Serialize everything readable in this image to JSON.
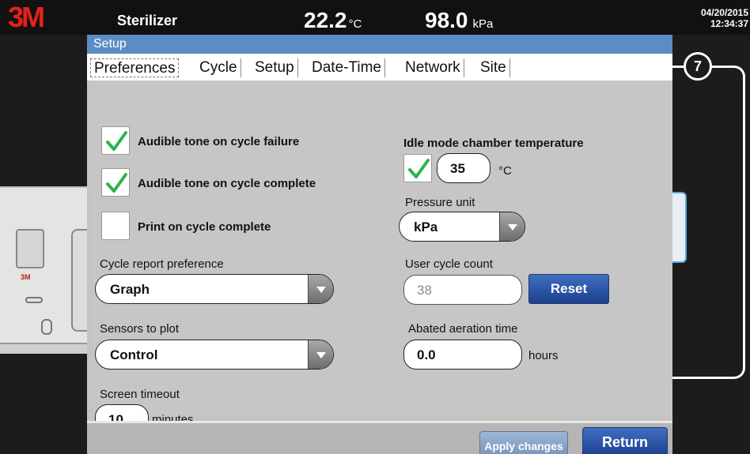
{
  "header": {
    "logo": "3M",
    "app_name": "Sterilizer",
    "temperature": "22.2",
    "temperature_unit": "°C",
    "pressure": "98.0",
    "pressure_unit": "kPa",
    "date": "04/20/2015",
    "time": "12:34:37"
  },
  "callout": {
    "number": "7"
  },
  "background": {
    "machine_logo": "3M"
  },
  "dialog": {
    "title": "Setup",
    "tabs": [
      {
        "label": "Preferences",
        "active": true
      },
      {
        "label": "Cycle",
        "active": false
      },
      {
        "label": "Setup",
        "active": false
      },
      {
        "label": "Date-Time",
        "active": false
      },
      {
        "label": "Network",
        "active": false
      },
      {
        "label": "Site",
        "active": false
      }
    ],
    "left": {
      "audible_failure": {
        "label": "Audible tone on cycle failure",
        "checked": true
      },
      "audible_complete": {
        "label": "Audible tone on cycle complete",
        "checked": true
      },
      "print_complete": {
        "label": "Print on cycle complete",
        "checked": false
      },
      "report_pref": {
        "label": "Cycle report preference",
        "value": "Graph"
      },
      "sensors": {
        "label": "Sensors to plot",
        "value": "Control"
      },
      "timeout": {
        "label": "Screen timeout",
        "value": "10",
        "unit": "minutes"
      }
    },
    "right": {
      "idle_temp": {
        "label": "Idle mode chamber temperature",
        "checked": true,
        "value": "35",
        "unit": "°C"
      },
      "pressure_unit": {
        "label": "Pressure unit",
        "value": "kPa"
      },
      "cycle_count": {
        "label": "User cycle count",
        "value": "38",
        "reset_label": "Reset"
      },
      "aeration": {
        "label": "Abated aeration time",
        "value": "0.0",
        "unit": "hours"
      }
    },
    "footer": {
      "apply_label": "Apply changes",
      "return_label": "Return"
    }
  },
  "colors": {
    "accent": "#1d3f8f",
    "title_bar": "#5b8cc3",
    "logo": "#e8201a",
    "check": "#2fb34a"
  }
}
